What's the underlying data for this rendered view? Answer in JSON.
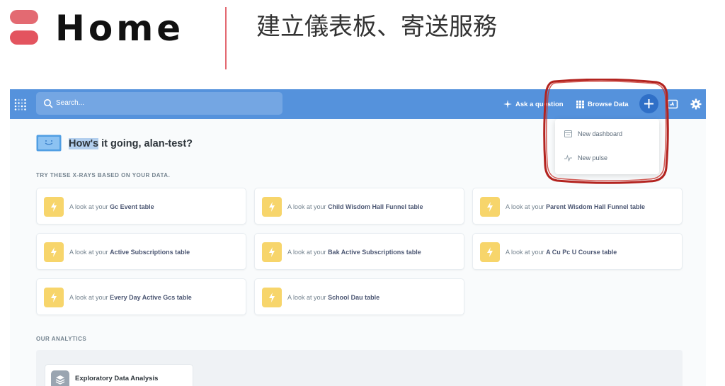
{
  "slide": {
    "title": "Home",
    "subtitle": "建立儀表板、寄送服務",
    "accent_color": "#e36a72"
  },
  "navbar": {
    "search_placeholder": "Search...",
    "ask_label": "Ask a question",
    "browse_label": "Browse Data",
    "bg_color": "#5592dc"
  },
  "dropdown": {
    "items": [
      {
        "label": "New dashboard",
        "icon": "dashboard-icon"
      },
      {
        "label": "New pulse",
        "icon": "pulse-icon"
      }
    ]
  },
  "greeting": {
    "highlighted": "How's",
    "rest": " it going, alan-test?"
  },
  "xrays": {
    "section_label": "TRY THESE X-RAYS BASED ON YOUR DATA.",
    "prefix": "A look at your",
    "cards": [
      {
        "table": "Gc Event table"
      },
      {
        "table": "Child Wisdom Hall Funnel table"
      },
      {
        "table": "Parent Wisdom Hall Funnel table"
      },
      {
        "table": "Active Subscriptions table"
      },
      {
        "table": "Bak Active Subscriptions table"
      },
      {
        "table": "A Cu Pc U Course table"
      },
      {
        "table": "Every Day Active Gcs table"
      },
      {
        "table": "School Dau table"
      }
    ]
  },
  "analytics": {
    "section_label": "OUR ANALYTICS",
    "collection": "Exploratory Data Analysis"
  }
}
